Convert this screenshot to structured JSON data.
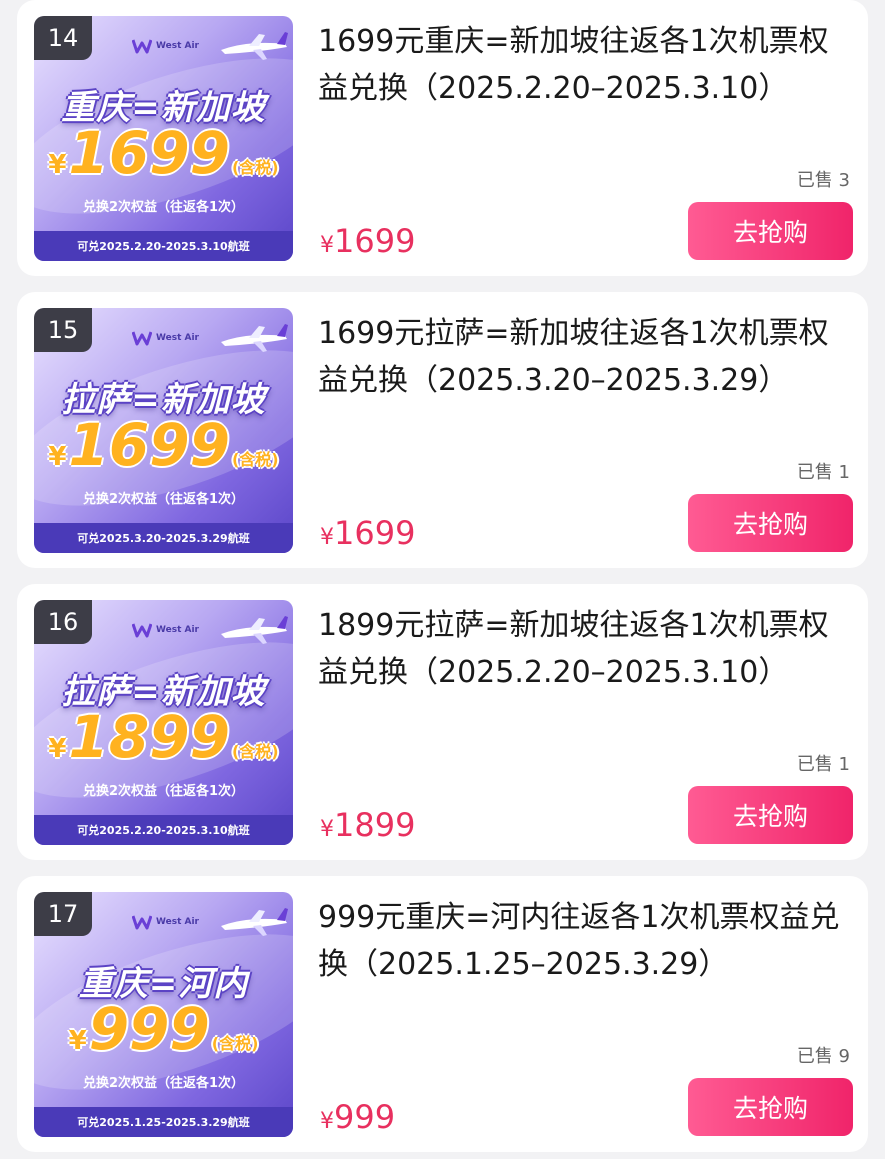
{
  "products": [
    {
      "rank": "14",
      "logo_text": "West Air",
      "banner_route": "重庆=新加坡",
      "banner_yen": "¥",
      "banner_price": "1699",
      "banner_tax": "(含税)",
      "banner_subline": "兑换2次权益（往返各1次）",
      "banner_footer": "可兑2025.2.20-2025.3.10航班",
      "title": "1699元重庆=新加坡往返各1次机票权益兑换（2025.2.20–2025.3.10）",
      "sold": "已售 3",
      "price_currency": "¥",
      "price": "1699",
      "buy_label": "去抢购"
    },
    {
      "rank": "15",
      "logo_text": "West Air",
      "banner_route": "拉萨=新加坡",
      "banner_yen": "¥",
      "banner_price": "1699",
      "banner_tax": "(含税)",
      "banner_subline": "兑换2次权益（往返各1次）",
      "banner_footer": "可兑2025.3.20-2025.3.29航班",
      "title": "1699元拉萨=新加坡往返各1次机票权益兑换（2025.3.20–2025.3.29）",
      "sold": "已售 1",
      "price_currency": "¥",
      "price": "1699",
      "buy_label": "去抢购"
    },
    {
      "rank": "16",
      "logo_text": "West Air",
      "banner_route": "拉萨=新加坡",
      "banner_yen": "¥",
      "banner_price": "1899",
      "banner_tax": "(含税)",
      "banner_subline": "兑换2次权益（往返各1次）",
      "banner_footer": "可兑2025.2.20-2025.3.10航班",
      "title": "1899元拉萨=新加坡往返各1次机票权益兑换（2025.2.20–2025.3.10）",
      "sold": "已售 1",
      "price_currency": "¥",
      "price": "1899",
      "buy_label": "去抢购"
    },
    {
      "rank": "17",
      "logo_text": "West Air",
      "banner_route": "重庆=河内",
      "banner_yen": "¥",
      "banner_price": "999",
      "banner_tax": "(含税)",
      "banner_subline": "兑换2次权益（往返各1次）",
      "banner_footer": "可兑2025.1.25-2025.3.29航班",
      "title": "999元重庆=河内往返各1次机票权益兑换（2025.1.25–2025.3.29）",
      "sold": "已售 9",
      "price_currency": "¥",
      "price": "999",
      "buy_label": "去抢购"
    }
  ],
  "icons": {
    "logo": "west-air-logo-icon",
    "plane": "airplane-icon"
  },
  "colors": {
    "price": "#e8305f",
    "button": "#f0246a",
    "banner_footer": "#4a3ab8",
    "banner_price": "#ffb21f"
  }
}
